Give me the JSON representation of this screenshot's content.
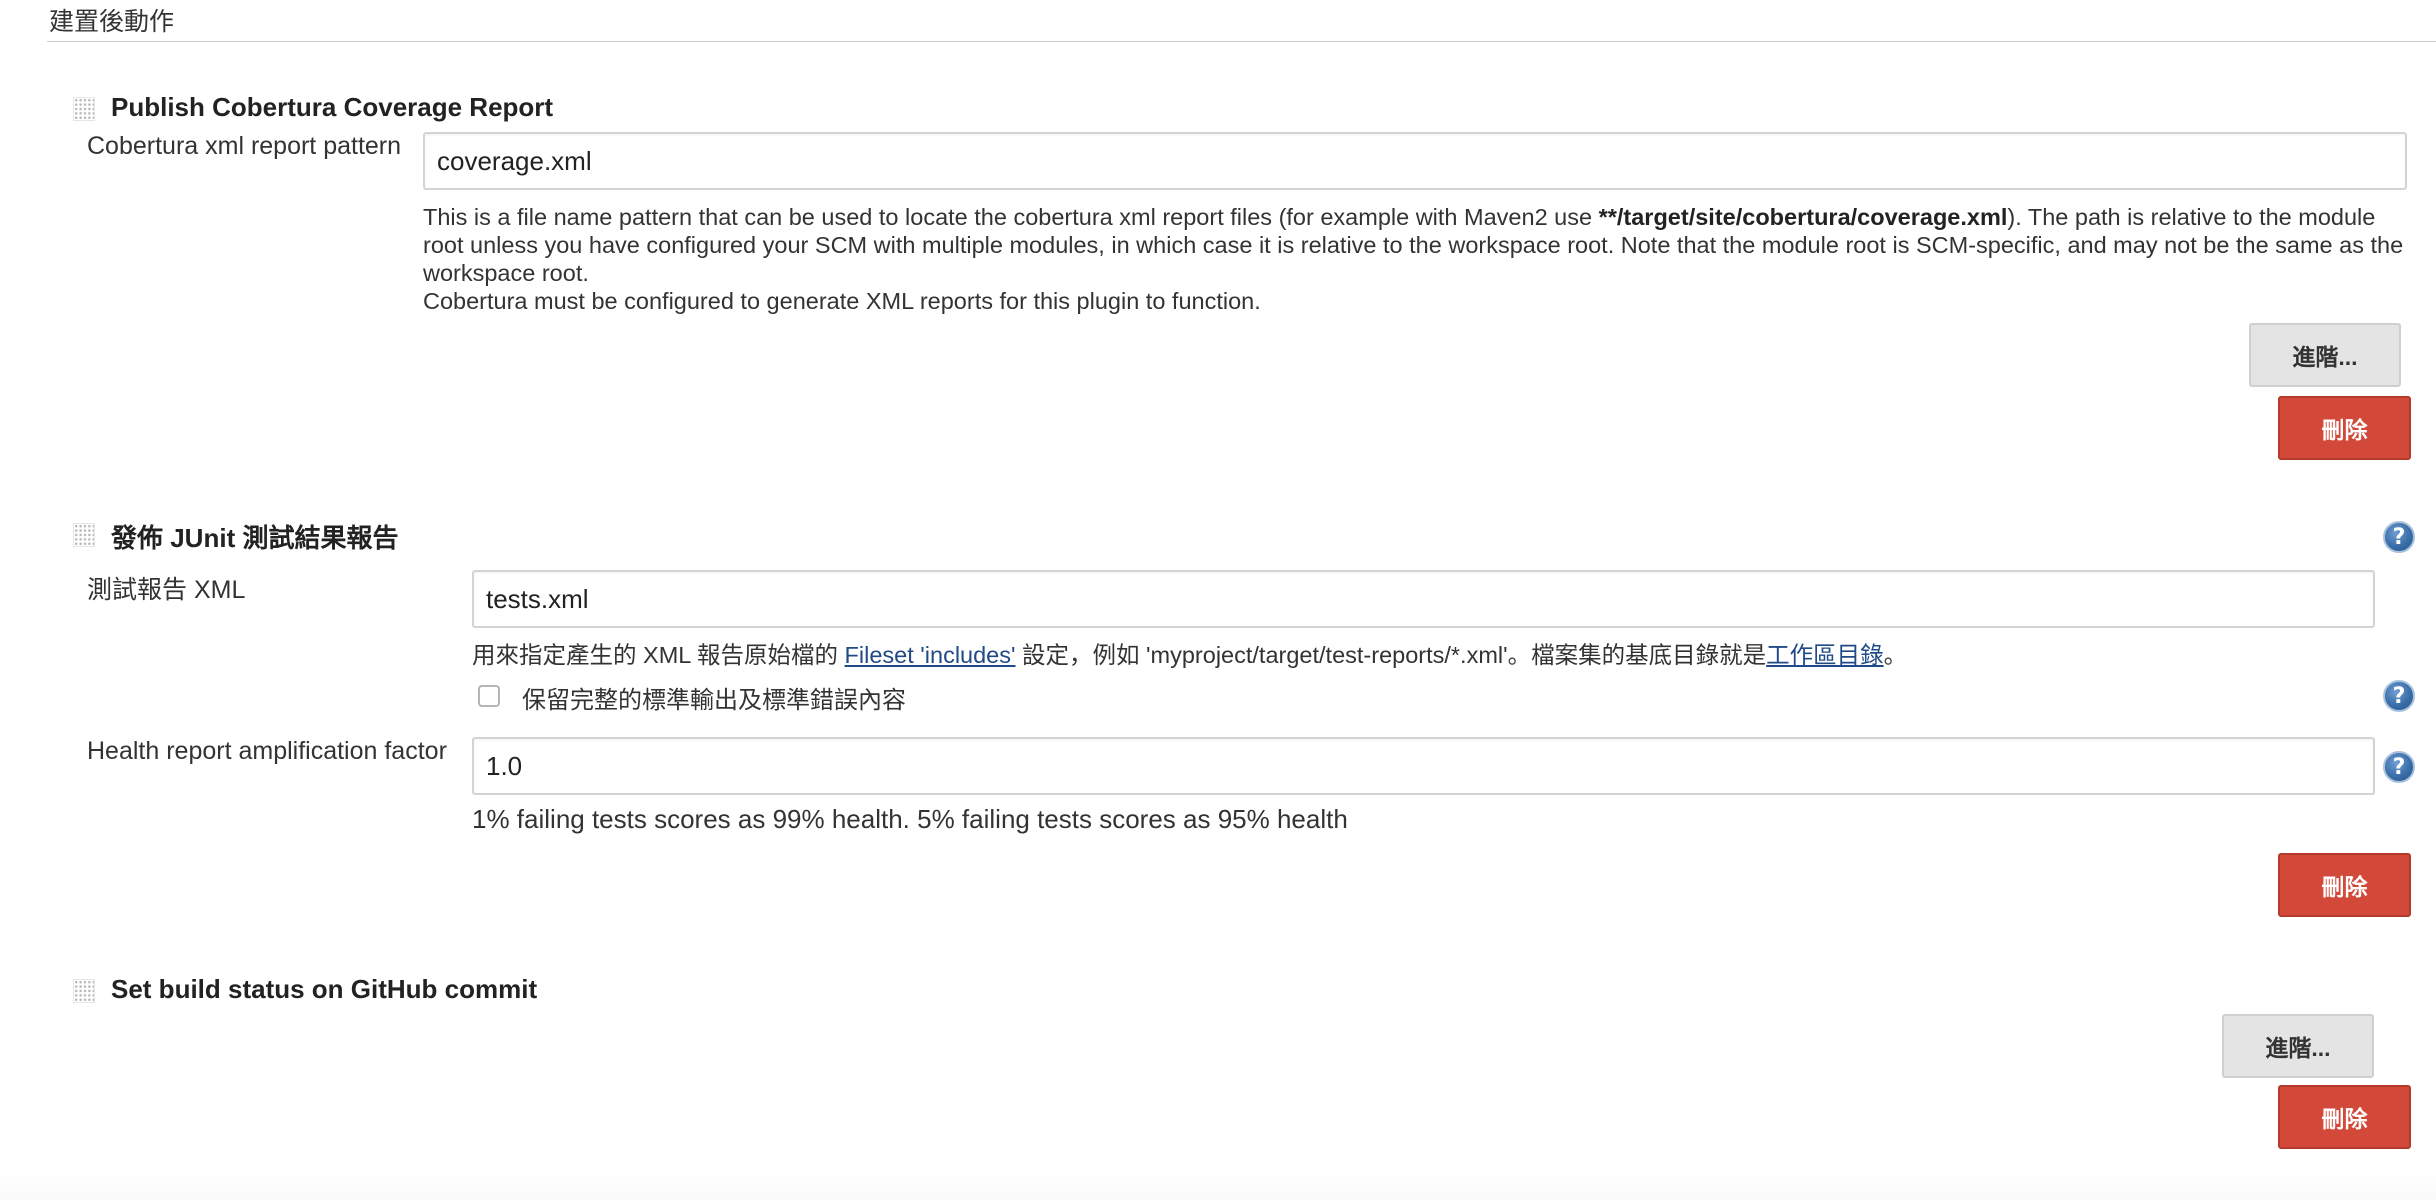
{
  "section": {
    "title": "建置後動作"
  },
  "cobertura": {
    "title": "Publish Cobertura Coverage Report",
    "pattern_label": "Cobertura xml report pattern",
    "pattern_value": "coverage.xml",
    "help_part1": "This is a file name pattern that can be used to locate the cobertura xml report files (for example with Maven2 use ",
    "help_bold": "**/target/site/cobertura/coverage.xml",
    "help_part2": "). The path is relative to the module root unless you have configured your SCM with multiple modules, in which case it is relative to the workspace root. Note that the module root is SCM-specific, and may not be the same as the workspace root.",
    "help_line2": "Cobertura must be configured to generate XML reports for this plugin to function.",
    "advanced_label": "進階...",
    "delete_label": "刪除"
  },
  "junit": {
    "title": "發佈 JUnit 測試結果報告",
    "xml_label": "測試報告 XML",
    "xml_value": "tests.xml",
    "help_prefix": "用來指定產生的 XML 報告原始檔的 ",
    "help_link1": "Fileset 'includes'",
    "help_middle": " 設定，例如 'myproject/target/test-reports/*.xml'。檔案集的基底目錄就是",
    "help_link2": "工作區目錄",
    "help_suffix": "。",
    "keep_output_label": "保留完整的標準輸出及標準錯誤內容",
    "keep_output_checked": false,
    "health_label": "Health report amplification factor",
    "health_value": "1.0",
    "health_help": "1% failing tests scores as 99% health. 5% failing tests scores as 95% health",
    "delete_label": "刪除"
  },
  "github": {
    "title": "Set build status on GitHub commit",
    "advanced_label": "進階...",
    "delete_label": "刪除"
  },
  "icons": {
    "drag_handle": "drag-handle-icon",
    "help": "help-icon"
  },
  "colors": {
    "delete_button": "#d24939",
    "advanced_button": "#e4e4e4",
    "link": "#204a87",
    "help_icon": "#3a6ea8"
  }
}
